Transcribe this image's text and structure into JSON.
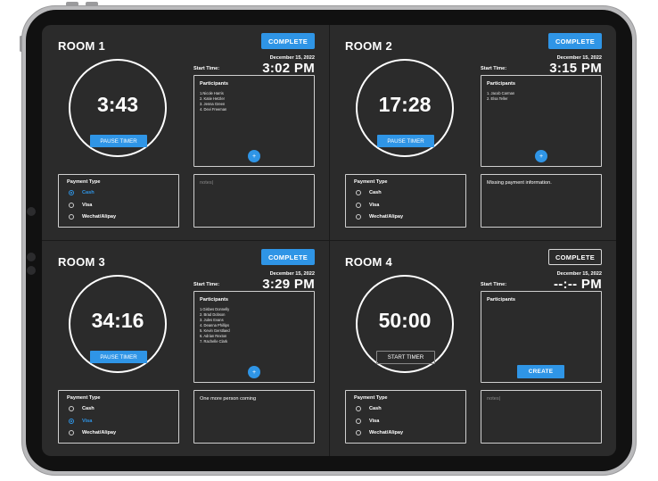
{
  "rooms": [
    {
      "title": "ROOM 1",
      "complete_label": "COMPLETE",
      "date": "December 15, 2022",
      "start_time": "3:02 PM",
      "start_time_label": "Start Time:",
      "timer": "3:43",
      "timer_button": "PAUSE TIMER",
      "participants_title": "Participants",
      "participants": [
        "1.Nicole Harris",
        "2. Katie Hetzler",
        "3. Jenna Green",
        "4. Devi Freeman"
      ],
      "add_button": "+",
      "payment_title": "Payment Type",
      "payment_options": [
        "Cash",
        "Visa",
        "Wechat/Alipay"
      ],
      "payment_selected": "Cash",
      "notes": "notes|"
    },
    {
      "title": "ROOM 2",
      "complete_label": "COMPLETE",
      "date": "December 15, 2022",
      "start_time": "3:15 PM",
      "start_time_label": "Start Time:",
      "timer": "17:28",
      "timer_button": "PAUSE TIMER",
      "participants_title": "Participants",
      "participants": [
        "1. Jacob Carman",
        "2. Elsa Teller"
      ],
      "add_button": "+",
      "payment_title": "Payment Type",
      "payment_options": [
        "Cash",
        "Visa",
        "Wechat/Alipay"
      ],
      "payment_selected": "",
      "notes": "Missing payment information."
    },
    {
      "title": "ROOM 3",
      "complete_label": "COMPLETE",
      "date": "December 15, 2022",
      "start_time": "3:29 PM",
      "start_time_label": "Start Time:",
      "timer": "34:16",
      "timer_button": "PAUSE TIMER",
      "participants_title": "Participants",
      "participants": [
        "1.Gisbes Donnelly",
        "2. Brad Dobson",
        "3. Jules Evans",
        "4. Deanna Phillips",
        "5. Kevin Gerstlaed",
        "6. Adrian Rexton",
        "7. Rachelle Clark"
      ],
      "add_button": "+",
      "payment_title": "Payment Type",
      "payment_options": [
        "Cash",
        "Visa",
        "Wechat/Alipay"
      ],
      "payment_selected": "Visa",
      "notes": "One more person coming"
    },
    {
      "title": "ROOM 4",
      "complete_label": "COMPLETE",
      "date": "December 15, 2022",
      "start_time": "--:-- PM",
      "start_time_label": "Start Time:",
      "timer": "50:00",
      "timer_button": "START TIMER",
      "participants_title": "Participants",
      "participants": [],
      "create_button": "CREATE",
      "payment_title": "Payment Type",
      "payment_options": [
        "Cash",
        "Visa",
        "Wechat/Alipay"
      ],
      "payment_selected": "",
      "notes": "notes|"
    }
  ],
  "colors": {
    "accent": "#2f95e6",
    "panel": "#2b2b2b"
  }
}
